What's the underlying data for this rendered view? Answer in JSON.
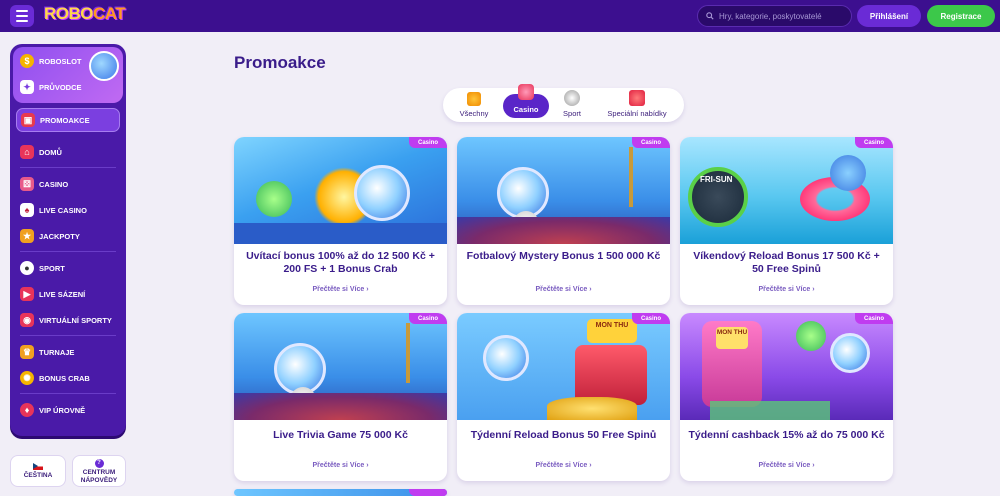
{
  "header": {
    "logo": "ROBO",
    "logo_accent": "CAT",
    "search_placeholder": "Hry, kategorie, poskytovatelé",
    "login_label": "Přihlášení",
    "register_label": "Registrace"
  },
  "sidebar": {
    "top_items": [
      {
        "label": "ROBOSLOT",
        "icon": "coin-icon"
      },
      {
        "label": "PRŮVODCE",
        "icon": "guide-icon"
      }
    ],
    "items": [
      {
        "label": "PROMOAKCE",
        "icon": "gift-icon"
      },
      {
        "label": "DOMŮ",
        "icon": "home-icon"
      },
      {
        "label": "CASINO",
        "icon": "dice-icon"
      },
      {
        "label": "LIVE CASINO",
        "icon": "cards-icon"
      },
      {
        "label": "JACKPOTY",
        "icon": "jackpot-icon"
      },
      {
        "label": "SPORT",
        "icon": "soccer-ball-icon"
      },
      {
        "label": "LIVE SÁZENÍ",
        "icon": "live-bet-icon"
      },
      {
        "label": "VIRTUÁLNÍ SPORTY",
        "icon": "virtual-sports-icon"
      },
      {
        "label": "TURNAJE",
        "icon": "trophy-icon"
      },
      {
        "label": "BONUS CRAB",
        "icon": "crab-icon"
      },
      {
        "label": "VIP ÚROVNĚ",
        "icon": "vip-icon"
      }
    ],
    "language_label": "ČEŠTINA",
    "help_label_1": "CENTRUM",
    "help_label_2": "NÁPOVĚDY"
  },
  "main": {
    "title": "Promoakce",
    "tabs": [
      {
        "label": "Všechny",
        "active": false
      },
      {
        "label": "Casino",
        "active": true
      },
      {
        "label": "Sport",
        "active": false
      },
      {
        "label": "Speciální nabídky",
        "active": false
      }
    ],
    "cards": [
      {
        "badge": "Casino",
        "title": "Uvítací bonus 100% až do 12 500 Kč + 200 FS + 1 Bonus Crab",
        "more": "Přečtěte si Více"
      },
      {
        "badge": "Casino",
        "title": "Fotbalový Mystery Bonus 1 500 000 Kč",
        "more": "Přečtěte si Více"
      },
      {
        "badge": "Casino",
        "title": "Víkendový Reload Bonus 17 500 Kč + 50 Free Spinů",
        "more": "Přečtěte si Více"
      },
      {
        "badge": "Casino",
        "title": "Live Trivia Game 75 000 Kč",
        "more": "Přečtěte si Více"
      },
      {
        "badge": "Casino",
        "title": "Týdenní Reload Bonus 50 Free Spinů",
        "more": "Přečtěte si Více"
      },
      {
        "badge": "Casino",
        "title": "Týdenní cashback 15% až do 75 000 Kč",
        "more": "Přečtěte si Více"
      }
    ],
    "card_art_text": {
      "fri_sun": "FRI-SUN",
      "mon_thu": "MON THU"
    }
  },
  "colors": {
    "header_bg": "#3c0f8f",
    "sidebar_bg": "#4a1aa8",
    "accent": "#5a25c8",
    "register": "#3cc84a",
    "badge": "#c03cf0",
    "page_bg": "#f1eef7"
  }
}
